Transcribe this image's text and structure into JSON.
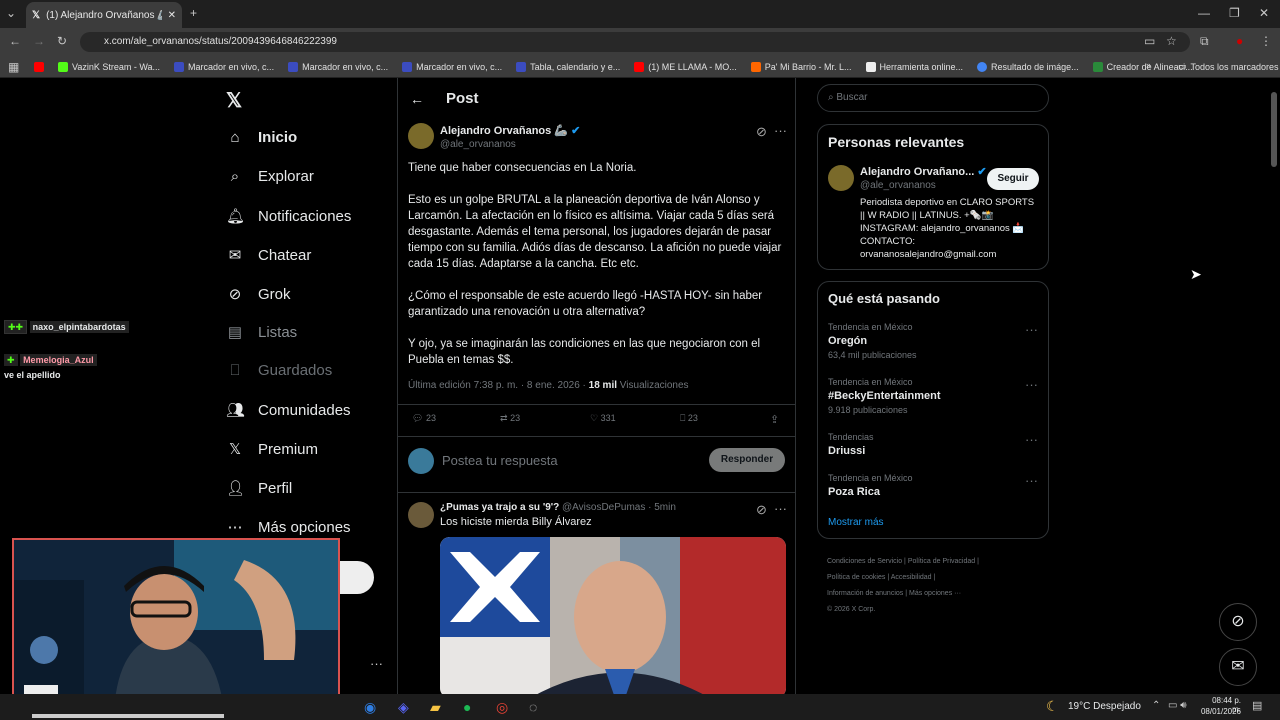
{
  "browser": {
    "tab_title": "(1) Alejandro Orvañanos 🦾 en",
    "url": "x.com/ale_orvananos/status/2009439646846222399",
    "bookmarks": [
      "VazinK Stream - Wa...",
      "Marcador en vivo, c...",
      "Marcador en vivo, c...",
      "Marcador en vivo, c...",
      "Tabla, calendario y e...",
      "(1) ME LLAMA - MO...",
      "Pa' Mi Barrio - Mr. L...",
      "Herramienta online...",
      "Resultado de imáge...",
      "Creador de Alineaci..."
    ],
    "all_bookmarks": "Todos los marcadores"
  },
  "nav": [
    "Inicio",
    "Explorar",
    "Notificaciones",
    "Chatear",
    "Grok",
    "Listas",
    "Guardados",
    "Comunidades",
    "Premium",
    "Perfil",
    "Más opciones"
  ],
  "post": {
    "header": "Post",
    "author_name": "Alejandro Orvañanos 🦾",
    "author_handle": "@ale_orvananos",
    "p1": "Tiene que haber consecuencias en La Noria.",
    "p2": "Esto es un golpe BRUTAL a la planeación deportiva de Iván Alonso y Larcamón. La afectación en lo físico es altísima. Viajar cada 5 días será desgastante. Además el tema personal, los jugadores dejarán de pasar tiempo con su familia. Adiós días de descanso. La afición no puede viajar cada 15 días. Adaptarse a la cancha. Etc etc.",
    "p3": "¿Cómo el responsable de este acuerdo llegó -HASTA HOY- sin haber garantizado una renovación u otra alternativa?",
    "p4": "Y ojo, ya se imaginarán las condiciones en las que negociaron con el Puebla en temas $$.",
    "meta_time": "Última edición 7:38 p. m. · 8 ene. 2026 ·",
    "views": "18 mil",
    "views_label": "Visualizaciones",
    "replies": "23",
    "reposts": "23",
    "likes": "331",
    "bookmarks": "23",
    "reply_placeholder": "Postea tu respuesta",
    "reply_button": "Responder"
  },
  "reply": {
    "name": "¿Pumas ya trajo a su '9'?",
    "handle": "@AvisosDePumas · 5min",
    "text": "Los hiciste mierda Billy Álvarez"
  },
  "search_placeholder": "Buscar",
  "relevant": {
    "title": "Personas relevantes",
    "name": "Alejandro Orvañano...",
    "handle": "@ale_orvananos",
    "follow": "Seguir",
    "bio": "Periodista deportivo en CLARO SPORTS || W RADIO || LATINUS. +🗞️📸 INSTAGRAM: alejandro_orvananos 📩 CONTACTO: orvananosalejandro@gmail.com"
  },
  "trends": {
    "title": "Qué está pasando",
    "items": [
      {
        "cat": "Tendencia en México",
        "name": "Oregón",
        "count": "63,4 mil publicaciones"
      },
      {
        "cat": "Tendencia en México",
        "name": "#BeckyEntertainment",
        "count": "9.918 publicaciones"
      },
      {
        "cat": "Tendencias",
        "name": "Driussi",
        "count": ""
      },
      {
        "cat": "Tendencia en México",
        "name": "Poza Rica",
        "count": ""
      }
    ],
    "more": "Mostrar más"
  },
  "footer": [
    "Condiciones de Servicio",
    "Política de Privacidad",
    "Política de cookies",
    "Accesibilidad",
    "Información de anuncios",
    "Más opciones ···",
    "© 2026 X Corp."
  ],
  "chat": {
    "user1": "naxo_elpintabardotas",
    "user2": "Memelogia_Azul",
    "msg2": "ve el apellido"
  },
  "taskbar": {
    "weather": "19°C  Despejado",
    "time": "08:44 p. m.",
    "date": "08/01/2026"
  }
}
